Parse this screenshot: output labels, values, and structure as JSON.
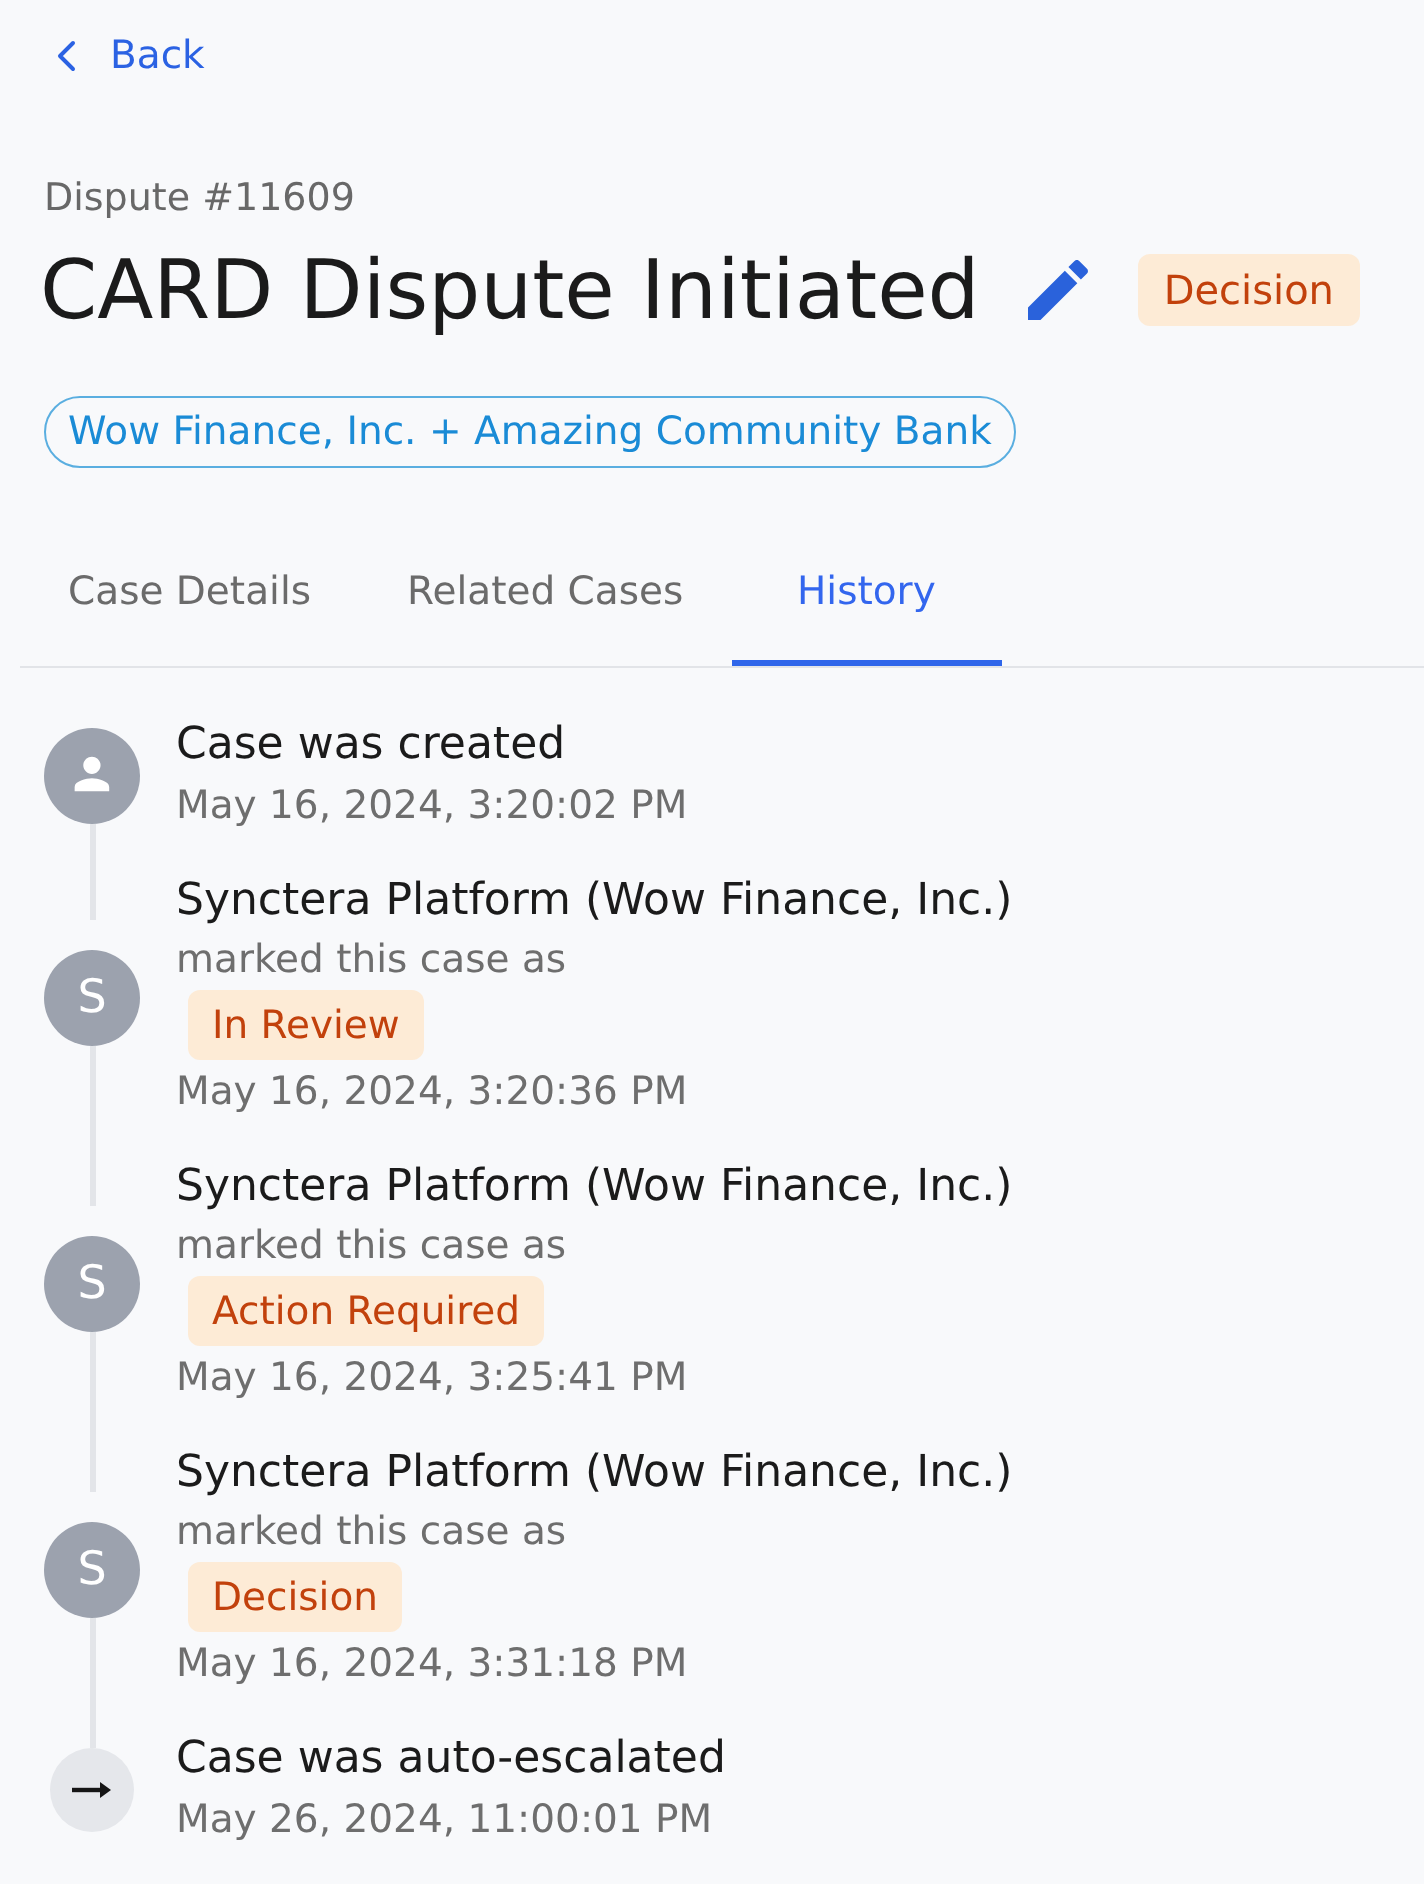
{
  "back": {
    "label": "Back"
  },
  "header": {
    "case_number": "Dispute #11609",
    "title": "CARD Dispute Initiated",
    "status": "Decision",
    "parties": "Wow Finance, Inc. + Amazing Community Bank"
  },
  "tabs": [
    {
      "label": "Case Details",
      "selected": false
    },
    {
      "label": "Related Cases",
      "selected": false
    },
    {
      "label": "History",
      "selected": true
    }
  ],
  "history": [
    {
      "kind": "user",
      "title": "Case was created",
      "time": "May 16, 2024, 3:20:02 PM"
    },
    {
      "kind": "actor",
      "initial": "S",
      "actor": "Synctera Platform (Wow Finance, Inc.)",
      "action": "marked this case as",
      "status": "In Review",
      "time": "May 16, 2024, 3:20:36 PM"
    },
    {
      "kind": "actor",
      "initial": "S",
      "actor": "Synctera Platform (Wow Finance, Inc.)",
      "action": "marked this case as",
      "status": "Action Required",
      "time": "May 16, 2024, 3:25:41 PM"
    },
    {
      "kind": "actor",
      "initial": "S",
      "actor": "Synctera Platform (Wow Finance, Inc.)",
      "action": "marked this case as",
      "status": "Decision",
      "time": "May 16, 2024, 3:31:18 PM"
    },
    {
      "kind": "system",
      "title": "Case was auto-escalated",
      "time": "May 26, 2024, 11:00:01 PM"
    }
  ]
}
